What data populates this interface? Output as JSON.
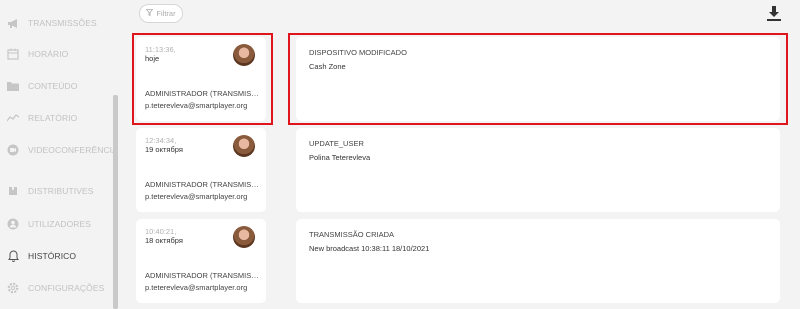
{
  "sidebar": {
    "items": [
      {
        "label": "TRANSMISSÕES",
        "icon": "megaphone-icon",
        "active": false
      },
      {
        "label": "HORÁRIO",
        "icon": "calendar-icon",
        "active": false
      },
      {
        "label": "CONTEÚDO",
        "icon": "folder-icon",
        "active": false
      },
      {
        "label": "RELATÓRIO",
        "icon": "trend-line-icon",
        "active": false
      },
      {
        "label": "VIDEOCONFERÊNCIA",
        "icon": "video-icon",
        "active": false
      },
      {
        "label": "DISTRIBUTIVES",
        "icon": "puzzle-icon",
        "active": false
      },
      {
        "label": "UTILIZADORES",
        "icon": "users-icon",
        "active": false
      },
      {
        "label": "HISTÓRICO",
        "icon": "bell-icon",
        "active": true
      },
      {
        "label": "CONFIGURAÇÕES",
        "icon": "gear-icon",
        "active": false
      }
    ]
  },
  "toolbar": {
    "filter_label": "Filtrar",
    "filter_icon": "funnel-icon",
    "download_icon": "download-icon"
  },
  "history": [
    {
      "time": "11:13:36,",
      "date": "hoje",
      "user_name": "ADMINISTRADOR (TRANSMISSÕES)",
      "user_email": "p.teterevleva@smartplayer.org",
      "event_title": "DISPOSITIVO MODIFICADO",
      "event_desc": "Cash Zone",
      "highlighted": true
    },
    {
      "time": "12:34:34,",
      "date": "19 октября",
      "user_name": "ADMINISTRADOR (TRANSMISSÕES)",
      "user_email": "p.teterevleva@smartplayer.org",
      "event_title": "UPDATE_USER",
      "event_desc": "Polina Teterevleva",
      "highlighted": false
    },
    {
      "time": "10:40:21,",
      "date": "18 октября",
      "user_name": "ADMINISTRADOR (TRANSMISSÕES)",
      "user_email": "p.teterevleva@smartplayer.org",
      "event_title": "TRANSMISSÃO CRIADA",
      "event_desc": "New broadcast 10:38:11 18/10/2021",
      "highlighted": false
    }
  ],
  "colors": {
    "highlight": "#e0141c",
    "sidebar_text": "#c2c2c2",
    "sidebar_active": "#444444"
  }
}
